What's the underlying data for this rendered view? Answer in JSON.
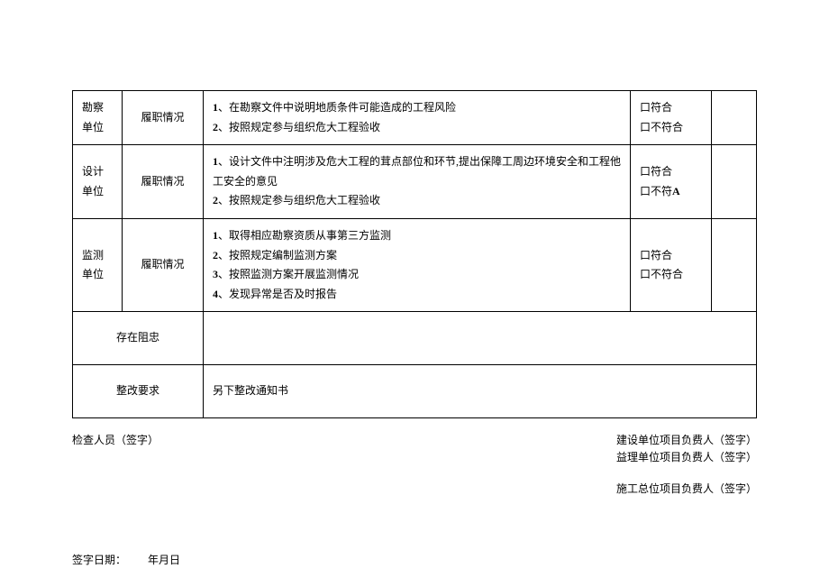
{
  "rows": [
    {
      "unit": "勘察单位",
      "duty": "履职情况",
      "desc1_num": "1",
      "desc1_text": "、在勘察文件中说明地质条件可能造成的工程风险",
      "desc2_num": "2",
      "desc2_text": "、按照规定参与组织危大工程验收",
      "result1": "口符合",
      "result2": "口不符合"
    },
    {
      "unit": "设计单位",
      "duty": "履职情况",
      "desc1_num": "1",
      "desc1_text": "、设计文件中注明涉及危大工程的茸点部位和环节,提出保障工周边环境安全和工程他工安全的意见",
      "desc2_num": "2",
      "desc2_text": "、按照规定参与组织危大工程验收",
      "result1": "口符合",
      "result2_prefix": "口不符",
      "result2_suffix": "A"
    },
    {
      "unit": "监测单位",
      "duty": "履职情况",
      "desc1_num": "1",
      "desc1_text": "、取得相应勘察资质从事第三方监测",
      "desc2_num": "2",
      "desc2_text": "、按照规定编制监测方案",
      "desc3_num": "3",
      "desc3_text": "、按照监测方案开展监测情况",
      "desc4_num": "4",
      "desc4_text": "、发现异常是否及时报告",
      "result1": "口符合",
      "result2": "口不符合"
    }
  ],
  "exist_hinder_label": "存在阻忠",
  "rectify_label": "整改要求",
  "rectify_content": "另下整改通知书",
  "inspector_label": "检查人员（签字）",
  "sig1": "建设单位项目负费人（签字）",
  "sig2": "益理单位项目负费人（签字）",
  "sig3": "施工总位项目负费人（签字）",
  "date_label": "签字日期：",
  "date_value": "年月日"
}
